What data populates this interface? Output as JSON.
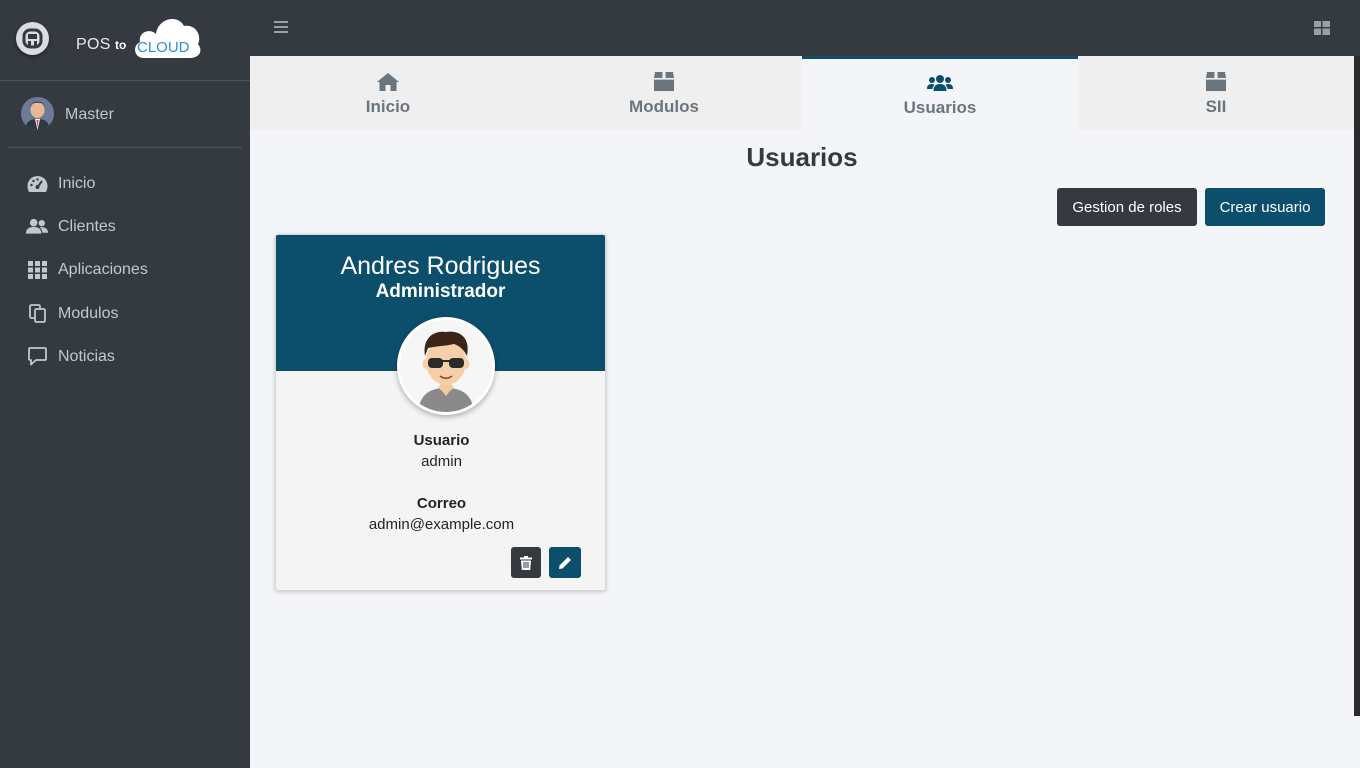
{
  "brand": {
    "text_pos": "POS",
    "text_to": "to",
    "text_cloud": "CLOUD"
  },
  "user_panel": {
    "name": "Master"
  },
  "sidebar": {
    "items": [
      {
        "label": "Inicio",
        "icon": "tachometer-icon"
      },
      {
        "label": "Clientes",
        "icon": "users-icon"
      },
      {
        "label": "Aplicaciones",
        "icon": "grid-icon"
      },
      {
        "label": "Modulos",
        "icon": "copy-icon"
      },
      {
        "label": "Noticias",
        "icon": "comment-icon"
      }
    ]
  },
  "tabs": [
    {
      "label": "Inicio",
      "icon": "home-icon",
      "active": false
    },
    {
      "label": "Modulos",
      "icon": "box-icon",
      "active": false
    },
    {
      "label": "Usuarios",
      "icon": "users-icon",
      "active": true
    },
    {
      "label": "SII",
      "icon": "box-icon",
      "active": false
    }
  ],
  "main": {
    "title": "Usuarios",
    "roles_button": "Gestion de roles",
    "create_button": "Crear usuario"
  },
  "user_card": {
    "name": "Andres Rodrigues",
    "role": "Administrador",
    "username_label": "Usuario",
    "username": "admin",
    "email_label": "Correo",
    "email": "admin@example.com"
  },
  "colors": {
    "sidebar_bg": "#343a40",
    "accent": "#0c4f6c",
    "page_bg": "#f4f5f9",
    "tab_bg": "#efefef"
  }
}
